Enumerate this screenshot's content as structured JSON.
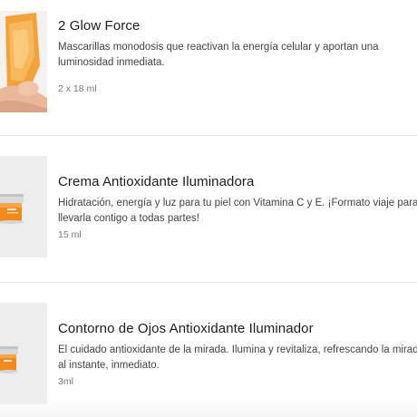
{
  "products": [
    {
      "title": "2 Glow Force",
      "description": "Mascarillas monodosis que reactivan la energía celular y aportan una luminosidad inmediata.",
      "size": "2 x 18 ml",
      "image_icon": "hand-holding-mask-pouch"
    },
    {
      "title": "Crema Antioxidante Iluminadora",
      "description": "Hidratación, energía y luz para tu piel con Vitamina C y E. ¡Formato viaje para llevarla contigo a todas partes!",
      "size": "15 ml",
      "image_icon": "cream-jar"
    },
    {
      "title": "Contorno de Ojos Antioxidante Iluminador",
      "description": "El cuidado antioxidante de la mirada. Ilumina y revitaliza, refrescando la mirada al instante, inmediato.",
      "size": "3ml",
      "image_icon": "eye-contour-jar"
    }
  ],
  "colors": {
    "brand_orange": "#f08a1c",
    "title_text": "#1d1d1d",
    "body_text": "#444444",
    "muted_text": "#777777"
  }
}
